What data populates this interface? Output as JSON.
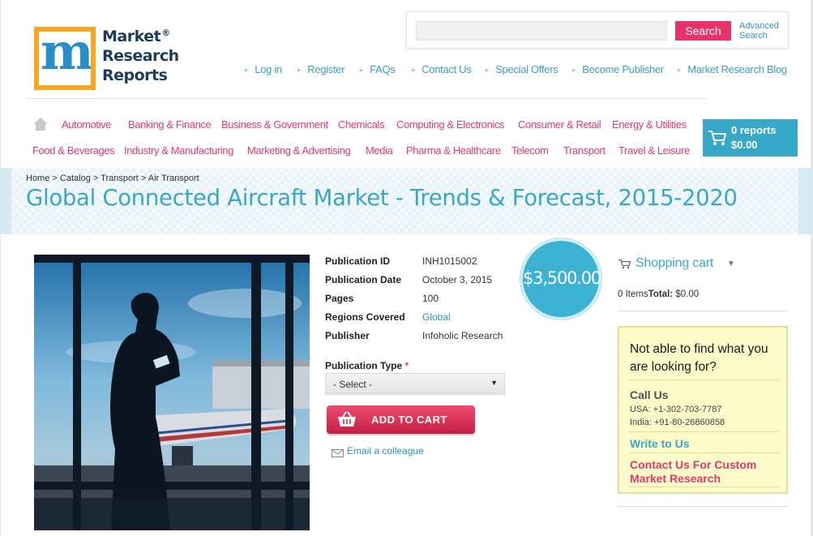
{
  "brand": {
    "line1": "Market",
    "line2": "Research",
    "line3": "Reports",
    "registered": "®",
    "logo_letter": "m"
  },
  "search": {
    "value": "",
    "placeholder": "",
    "button": "Search",
    "advanced_line1": "Advanced",
    "advanced_line2": "Search"
  },
  "top_links": [
    "Log in",
    "Register",
    "FAQs",
    "Contact Us",
    "Special Offers",
    "Become Publisher",
    "Market Research Blog"
  ],
  "nav": {
    "home_icon": "home-icon",
    "row1": [
      "Automotive",
      "Banking & Finance",
      "Business & Government",
      "Chemicals",
      "Computing & Electronics",
      "Consumer & Retail",
      "Energy & Utilities"
    ],
    "row2": [
      "Food & Beverages",
      "Industry & Manufacturing",
      "Marketing & Advertising",
      "Media",
      "Pharma & Healthcare",
      "Telecom",
      "Transport",
      "Travel & Leisure"
    ]
  },
  "cart_summary": {
    "count": "0 reports",
    "total": "$0.00"
  },
  "breadcrumb": [
    "Home",
    "Catalog",
    "Transport",
    "Air Transport"
  ],
  "breadcrumb_sep": " > ",
  "title": "Global Connected Aircraft Market - Trends & Forecast, 2015-2020",
  "details": {
    "publication_id": {
      "label": "Publication ID",
      "value": "INH1015002"
    },
    "publication_date": {
      "label": "Publication Date",
      "value": "October 3, 2015"
    },
    "pages": {
      "label": "Pages",
      "value": "100"
    },
    "regions": {
      "label": "Regions Covered",
      "value": "Global"
    },
    "publisher": {
      "label": "Publisher",
      "value": "Infoholic Research"
    }
  },
  "price": "$3,500.00",
  "publication_type": {
    "label": "Publication Type",
    "required_mark": "*",
    "selected": "- Select -"
  },
  "add_to_cart": "ADD TO CART",
  "email_colleague": "Email a colleague",
  "sidebar": {
    "cart_title": "Shopping cart",
    "items_text": "0 Items",
    "total_label": "Total:",
    "total_value": "$0.00",
    "help_question": "Not able to find what you are looking for?",
    "call_us": "Call Us",
    "usa": "USA: +1-302-703-7787",
    "india": "India: +91-80-26860858",
    "write_to_us": "Write to Us",
    "custom_research": "Contact Us For Custom Market Research"
  },
  "colors": {
    "accent_pink": "#e13a6e",
    "accent_blue": "#3aa7c6",
    "search_button": "#e6346a",
    "help_box_bg": "#fcfbc9"
  }
}
